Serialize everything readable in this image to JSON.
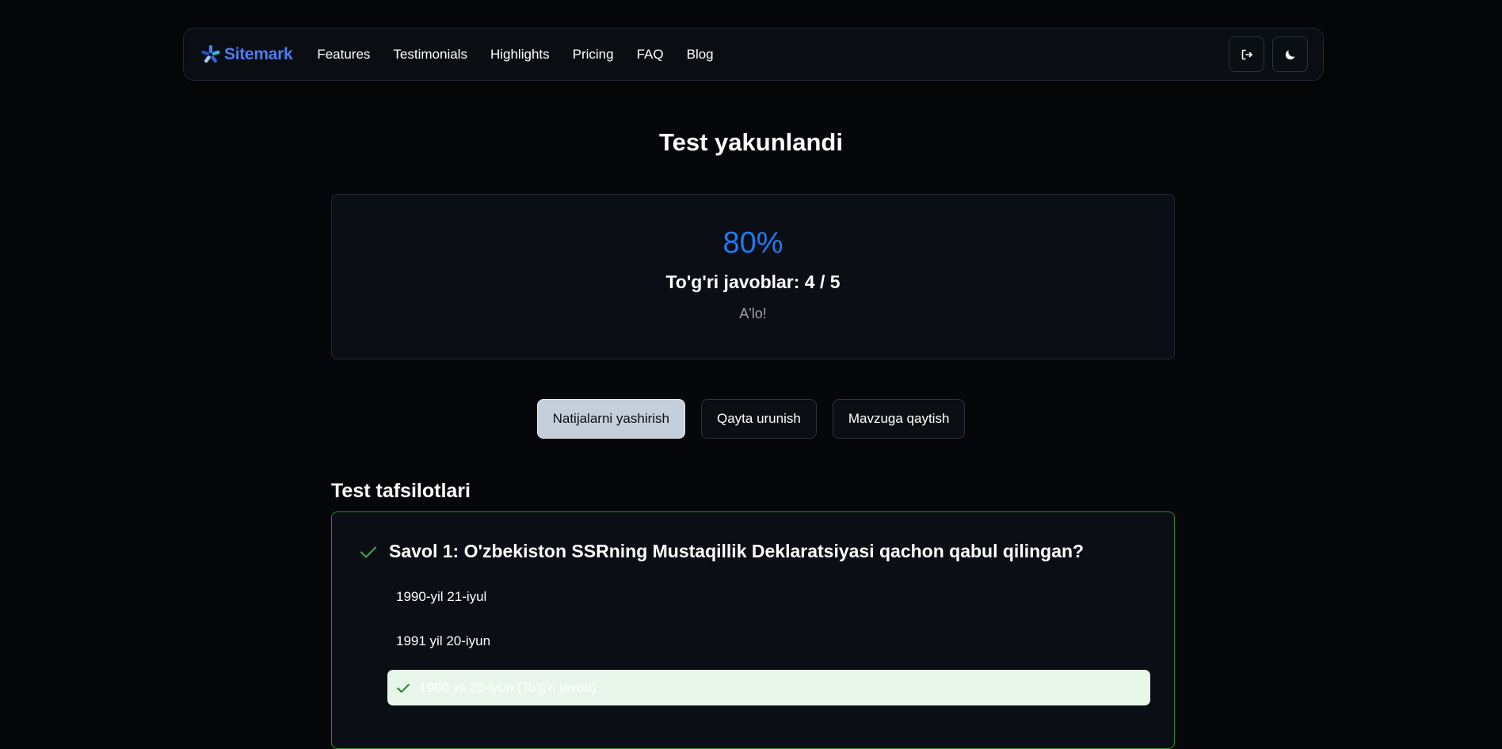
{
  "brand": {
    "name": "Sitemark"
  },
  "nav": {
    "links": [
      "Features",
      "Testimonials",
      "Highlights",
      "Pricing",
      "FAQ",
      "Blog"
    ],
    "actions": [
      {
        "icon": "logout-icon"
      },
      {
        "icon": "moon-icon"
      }
    ]
  },
  "page": {
    "title": "Test yakunlandi"
  },
  "result": {
    "percent": "80%",
    "correct_line": "To'g'ri javoblar: 4 / 5",
    "grade": "A'lo!"
  },
  "buttons": {
    "hide_results": "Natijalarni yashirish",
    "retry": "Qayta urunish",
    "back_to_topic": "Mavzuga qaytish"
  },
  "details": {
    "title": "Test tafsilotlari",
    "questions": [
      {
        "title": "Savol 1: O'zbekiston SSRning Mustaqillik Deklaratsiyasi qachon qabul qilingan?",
        "status": "correct",
        "options": [
          {
            "text": "1990-yil 21-iyul",
            "state": "normal"
          },
          {
            "text": "1991 yil 20-iyun",
            "state": "normal"
          },
          {
            "text": "1990 yil 20-iyun (To'g'ri javob)",
            "state": "correct"
          }
        ]
      }
    ]
  },
  "colors": {
    "background": "#05070a",
    "brand": "#4d7cf0",
    "percent": "#1e7af0",
    "correct_border": "#2f8a35",
    "correct_fill": "#e8f5e9"
  }
}
